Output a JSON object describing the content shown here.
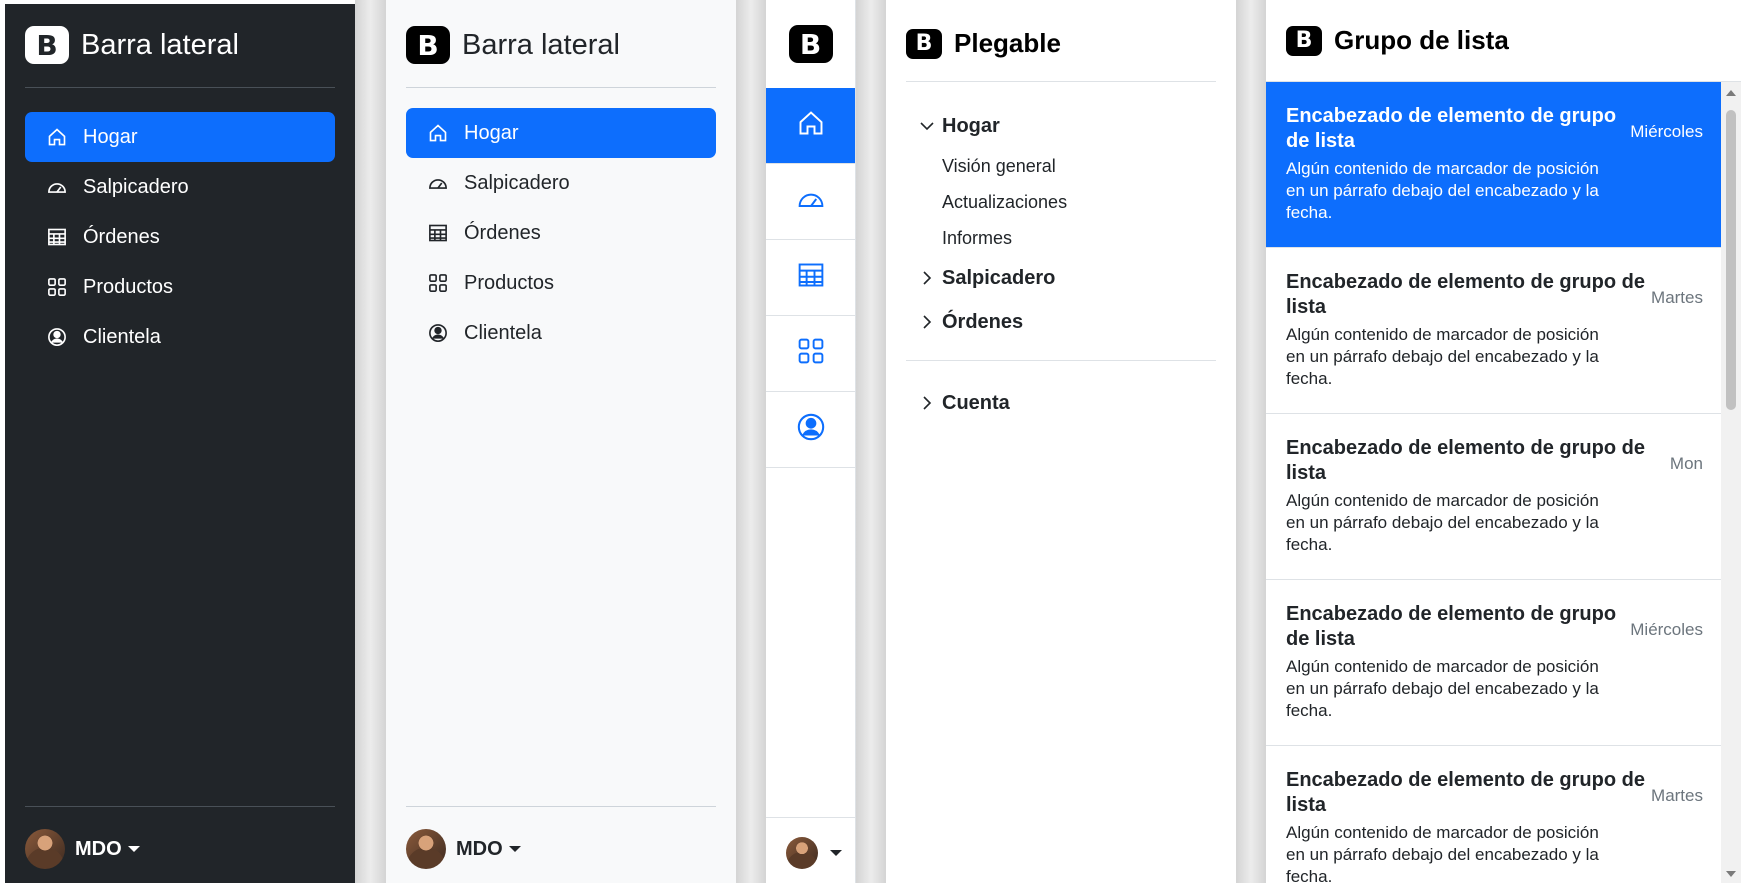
{
  "sidebar_dark": {
    "brand": "Barra lateral",
    "logo_letter": "B",
    "items": [
      {
        "label": "Hogar",
        "icon": "house-icon",
        "active": true
      },
      {
        "label": "Salpicadero",
        "icon": "speedometer-icon"
      },
      {
        "label": "Órdenes",
        "icon": "table-icon"
      },
      {
        "label": "Productos",
        "icon": "grid-icon"
      },
      {
        "label": "Clientela",
        "icon": "person-circle-icon"
      }
    ],
    "user": "MDO"
  },
  "sidebar_light": {
    "brand": "Barra lateral",
    "logo_letter": "B",
    "items": [
      {
        "label": "Hogar",
        "icon": "house-icon",
        "active": true
      },
      {
        "label": "Salpicadero",
        "icon": "speedometer-icon"
      },
      {
        "label": "Órdenes",
        "icon": "table-icon"
      },
      {
        "label": "Productos",
        "icon": "grid-icon"
      },
      {
        "label": "Clientela",
        "icon": "person-circle-icon"
      }
    ],
    "user": "MDO"
  },
  "icon_sidebar": {
    "logo_letter": "B",
    "icons": [
      "house-icon",
      "speedometer-icon",
      "table-icon",
      "grid-icon",
      "person-circle-icon"
    ]
  },
  "collapsible": {
    "logo_letter": "B",
    "title": "Plegable",
    "sections": [
      {
        "label": "Hogar",
        "expanded": true,
        "children": [
          "Visión general",
          "Actualizaciones",
          "Informes"
        ]
      },
      {
        "label": "Salpicadero",
        "expanded": false
      },
      {
        "label": "Órdenes",
        "expanded": false
      }
    ],
    "account": "Cuenta"
  },
  "list_group": {
    "logo_letter": "B",
    "title": "Grupo de lista",
    "items": [
      {
        "heading": "Encabezado de elemento de grupo de lista",
        "date": "Miércoles",
        "body": "Algún contenido de marcador de posición en un párrafo debajo del encabezado y la fecha.",
        "active": true
      },
      {
        "heading": "Encabezado de elemento de grupo de lista",
        "date": "Martes",
        "body": "Algún contenido de marcador de posición en un párrafo debajo del encabezado y la fecha."
      },
      {
        "heading": "Encabezado de elemento de grupo de lista",
        "date": "Mon",
        "body": "Algún contenido de marcador de posición en un párrafo debajo del encabezado y la fecha."
      },
      {
        "heading": "Encabezado de elemento de grupo de lista",
        "date": "Miércoles",
        "body": "Algún contenido de marcador de posición en un párrafo debajo del encabezado y la fecha."
      },
      {
        "heading": "Encabezado de elemento de grupo de lista",
        "date": "Martes",
        "body": "Algún contenido de marcador de posición en un párrafo debajo del encabezado y la fecha."
      }
    ]
  },
  "colors": {
    "accent": "#0d6efd",
    "dark": "#212529",
    "light": "#f8f9fa"
  }
}
